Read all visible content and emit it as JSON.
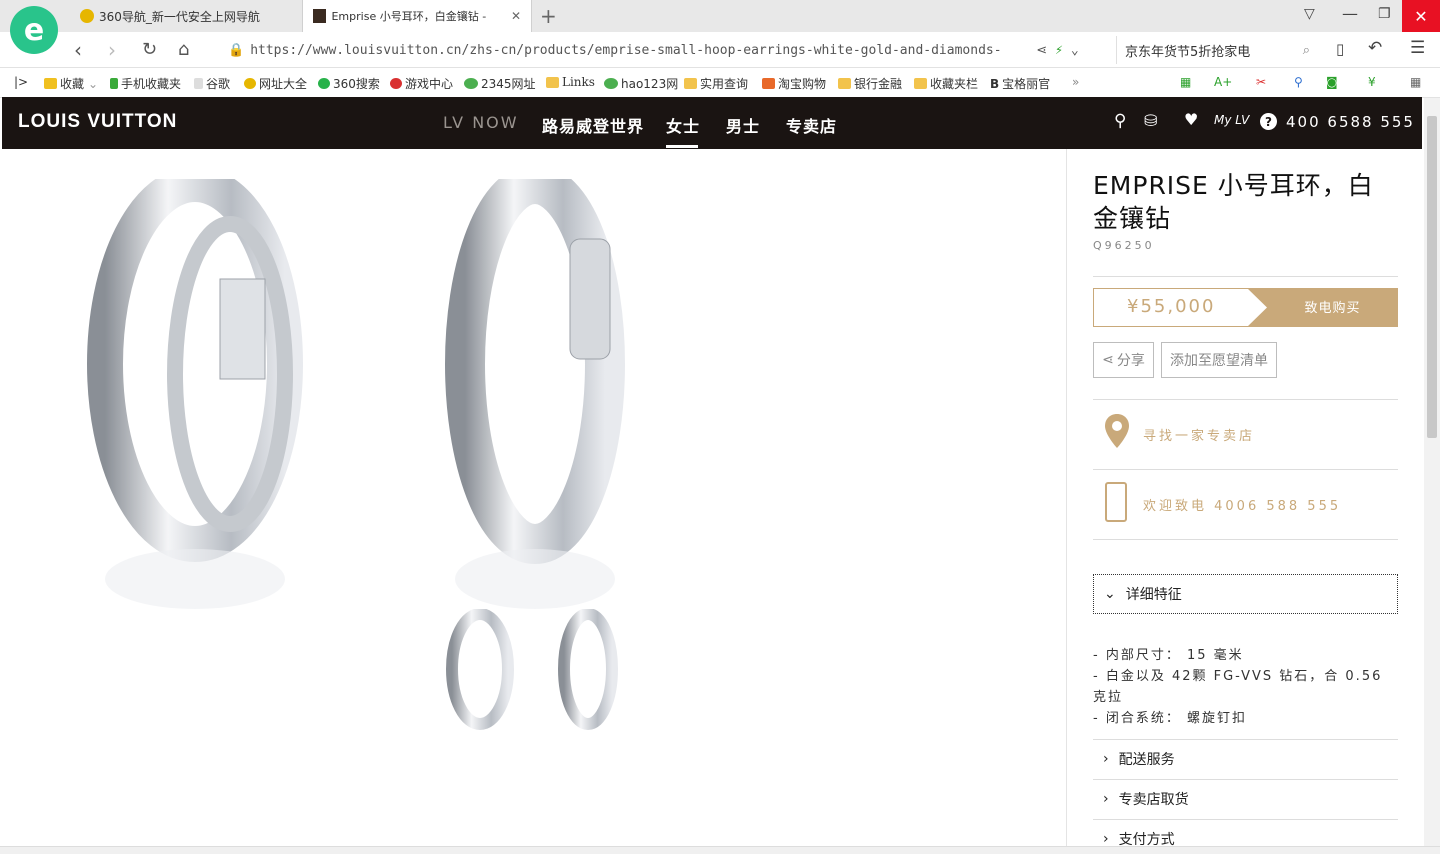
{
  "browser": {
    "tabs": [
      {
        "label": "360导航_新一代安全上网导航"
      },
      {
        "label": "Emprise 小号耳环，白金镶钻 -"
      }
    ],
    "url": "https://www.louisvuitton.cn/zhs-cn/products/emprise-small-hoop-earrings-white-gold-and-diamonds-",
    "search_text": "京东年货节5折抢家电",
    "bookmarks": [
      "收藏",
      "手机收藏夹",
      "谷歌",
      "网址大全",
      "360搜索",
      "游戏中心",
      "2345网址",
      "Links",
      "hao123网",
      "实用查询",
      "淘宝购物",
      "银行金融",
      "收藏夹栏",
      "宝格丽官"
    ]
  },
  "site": {
    "logo": "LOUIS VUITTON",
    "nav": [
      "LV NOW",
      "路易威登世界",
      "女士",
      "男士",
      "专卖店"
    ],
    "phone": "400 6588 555",
    "myfav": "My"
  },
  "product": {
    "title": "EMPRISE 小号耳环，白金镶钻",
    "sku": "Q96250",
    "price": "¥55,000",
    "buy_label": "致电购买",
    "share_label": "分享",
    "wishlist_label": "添加至愿望清单",
    "store_label": "寻找一家专卖店",
    "call_label": "欢迎致电 4006 588 555",
    "details_label": "详细特征",
    "details": [
      "- 内部尺寸： 15 毫米",
      "- 白金以及 42颗 FG-VVS 钻石，合 0.56 克拉",
      "- 闭合系统： 螺旋钉扣"
    ],
    "sections": [
      "配送服务",
      "专卖店取货",
      "支付方式"
    ]
  },
  "colors": {
    "brand_dark": "#1a1412",
    "gold": "#c9a97a"
  }
}
